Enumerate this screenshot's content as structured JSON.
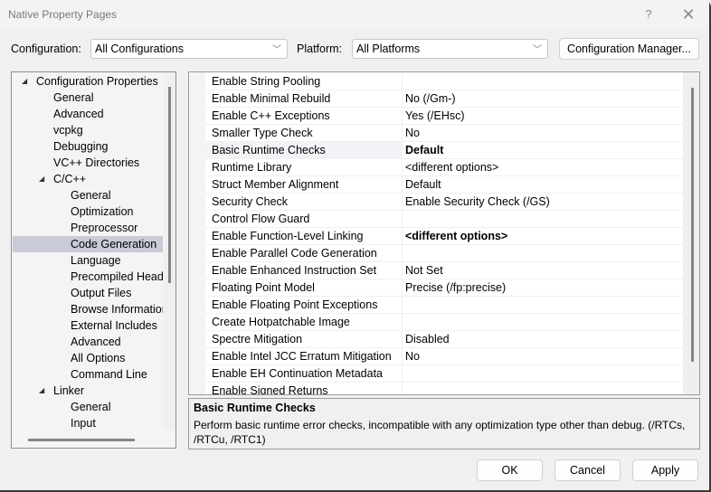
{
  "window": {
    "title": "Native Property Pages",
    "help_label": "?",
    "close_label": "✕"
  },
  "config": {
    "configuration_label": "Configuration:",
    "configuration_value": "All Configurations",
    "platform_label": "Platform:",
    "platform_value": "All Platforms",
    "manager_button": "Configuration Manager...",
    "chevron": "﹀"
  },
  "tree": {
    "items": [
      {
        "label": "Configuration Properties",
        "level": 0,
        "expanded": true
      },
      {
        "label": "General",
        "level": 1
      },
      {
        "label": "Advanced",
        "level": 1
      },
      {
        "label": "vcpkg",
        "level": 1
      },
      {
        "label": "Debugging",
        "level": 1
      },
      {
        "label": "VC++ Directories",
        "level": 1
      },
      {
        "label": "C/C++",
        "level": 1,
        "expanded": true
      },
      {
        "label": "General",
        "level": 2
      },
      {
        "label": "Optimization",
        "level": 2
      },
      {
        "label": "Preprocessor",
        "level": 2
      },
      {
        "label": "Code Generation",
        "level": 2,
        "selected": true
      },
      {
        "label": "Language",
        "level": 2
      },
      {
        "label": "Precompiled Headers",
        "level": 2
      },
      {
        "label": "Output Files",
        "level": 2
      },
      {
        "label": "Browse Information",
        "level": 2
      },
      {
        "label": "External Includes",
        "level": 2
      },
      {
        "label": "Advanced",
        "level": 2
      },
      {
        "label": "All Options",
        "level": 2
      },
      {
        "label": "Command Line",
        "level": 2
      },
      {
        "label": "Linker",
        "level": 1,
        "expanded": true
      },
      {
        "label": "General",
        "level": 2
      },
      {
        "label": "Input",
        "level": 2
      }
    ],
    "expand_arrow": "◢"
  },
  "properties": {
    "rows": [
      {
        "name": "Enable String Pooling",
        "value": ""
      },
      {
        "name": "Enable Minimal Rebuild",
        "value": "No (/Gm-)"
      },
      {
        "name": "Enable C++ Exceptions",
        "value": "Yes (/EHsc)"
      },
      {
        "name": "Smaller Type Check",
        "value": "No"
      },
      {
        "name": "Basic Runtime Checks",
        "value": "Default",
        "bold": true,
        "selected": true
      },
      {
        "name": "Runtime Library",
        "value": "<different options>"
      },
      {
        "name": "Struct Member Alignment",
        "value": "Default"
      },
      {
        "name": "Security Check",
        "value": "Enable Security Check (/GS)"
      },
      {
        "name": "Control Flow Guard",
        "value": ""
      },
      {
        "name": "Enable Function-Level Linking",
        "value": "<different options>",
        "bold": true
      },
      {
        "name": "Enable Parallel Code Generation",
        "value": ""
      },
      {
        "name": "Enable Enhanced Instruction Set",
        "value": "Not Set"
      },
      {
        "name": "Floating Point Model",
        "value": "Precise (/fp:precise)"
      },
      {
        "name": "Enable Floating Point Exceptions",
        "value": ""
      },
      {
        "name": "Create Hotpatchable Image",
        "value": ""
      },
      {
        "name": "Spectre Mitigation",
        "value": "Disabled"
      },
      {
        "name": "Enable Intel JCC Erratum Mitigation",
        "value": "No"
      },
      {
        "name": "Enable EH Continuation Metadata",
        "value": ""
      },
      {
        "name": "Enable Signed Returns",
        "value": ""
      }
    ]
  },
  "description": {
    "title": "Basic Runtime Checks",
    "text": "Perform basic runtime error checks, incompatible with any optimization type other than debug. (/RTCs, /RTCu, /RTC1)"
  },
  "buttons": {
    "ok": "OK",
    "cancel": "Cancel",
    "apply": "Apply"
  }
}
